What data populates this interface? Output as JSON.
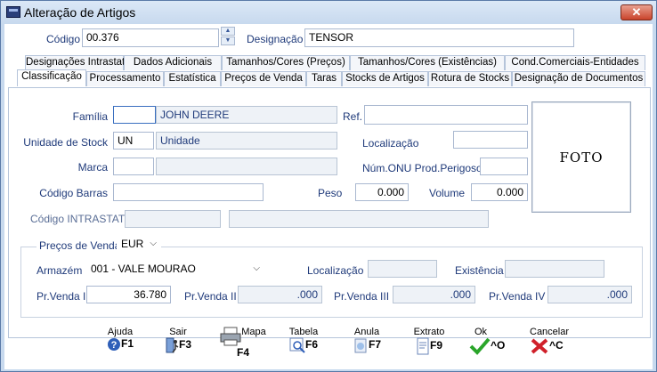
{
  "window": {
    "title": "Alteração de Artigos",
    "close_glyph": "✕"
  },
  "header": {
    "codigo_label": "Código",
    "codigo_value": "00.376",
    "designacao_label": "Designação",
    "designacao_value": "TENSOR"
  },
  "tabs_top": [
    {
      "label": "Designações Intrastat"
    },
    {
      "label": "Dados Adicionais"
    },
    {
      "label": "Tamanhos/Cores (Preços)"
    },
    {
      "label": "Tamanhos/Cores (Existências)"
    },
    {
      "label": "Cond.Comerciais-Entidades"
    }
  ],
  "tabs_bottom": [
    {
      "label": "Classificação"
    },
    {
      "label": "Processamento"
    },
    {
      "label": "Estatística"
    },
    {
      "label": "Preços de Venda"
    },
    {
      "label": "Taras"
    },
    {
      "label": "Stocks de Artigos"
    },
    {
      "label": "Rotura de Stocks"
    },
    {
      "label": "Designação de Documentos"
    }
  ],
  "form": {
    "familia_label": "Família",
    "familia_code": "",
    "familia_desc": "JOHN DEERE",
    "ref_label": "Ref.",
    "ref_value": "",
    "unidade_label": "Unidade de Stock",
    "unidade_code": "UN",
    "unidade_desc": "Unidade",
    "localizacao_label": "Localização",
    "localizacao_value": "",
    "marca_label": "Marca",
    "marca_code": "",
    "marca_desc": "",
    "onu_label": "Núm.ONU Prod.Perigosos",
    "onu_value": "",
    "codigo_barras_label": "Código Barras",
    "codigo_barras_value": "",
    "peso_label": "Peso",
    "peso_value": "0.000",
    "volume_label": "Volume",
    "volume_value": "0.000",
    "intrastat_label": "Código INTRASTAT",
    "intrastat_code": "",
    "intrastat_desc": "",
    "foto_label": "FOTO"
  },
  "precos": {
    "group_label": "Preços de Venda",
    "currency": "EUR",
    "armazem_label": "Armazém",
    "armazem_value": "001 - VALE MOURAO",
    "localizacao_label": "Localização",
    "localizacao_value": "",
    "existencia_label": "Existência",
    "existencia_value": "",
    "pv1_label": "Pr.Venda I",
    "pv1_value": "36.780",
    "pv2_label": "Pr.Venda II",
    "pv2_value": ".000",
    "pv3_label": "Pr.Venda III",
    "pv3_value": ".000",
    "pv4_label": "Pr.Venda IV",
    "pv4_value": ".000"
  },
  "toolbar": {
    "ajuda": {
      "label": "Ajuda",
      "key": "F1",
      "icon": "help-icon"
    },
    "sair": {
      "label": "Sair",
      "key": "F3",
      "icon": "exit-icon"
    },
    "mapa": {
      "label": "Mapa",
      "key": "F4",
      "icon": "printer-icon"
    },
    "tabela": {
      "label": "Tabela",
      "key": "F6",
      "icon": "table-search-icon"
    },
    "anula": {
      "label": "Anula",
      "key": "F7",
      "icon": "cancel-doc-icon"
    },
    "extrato": {
      "label": "Extrato",
      "key": "F9",
      "icon": "statement-icon"
    },
    "ok": {
      "label": "Ok",
      "key": "^O",
      "icon": "check-icon"
    },
    "cancelar": {
      "label": "Cancelar",
      "key": "^C",
      "icon": "x-icon"
    }
  },
  "colors": {
    "label_text": "#1f3a7a",
    "window_frame": "#c7d9ee",
    "ok_green": "#2aa52a",
    "cancel_red": "#d0202a"
  }
}
